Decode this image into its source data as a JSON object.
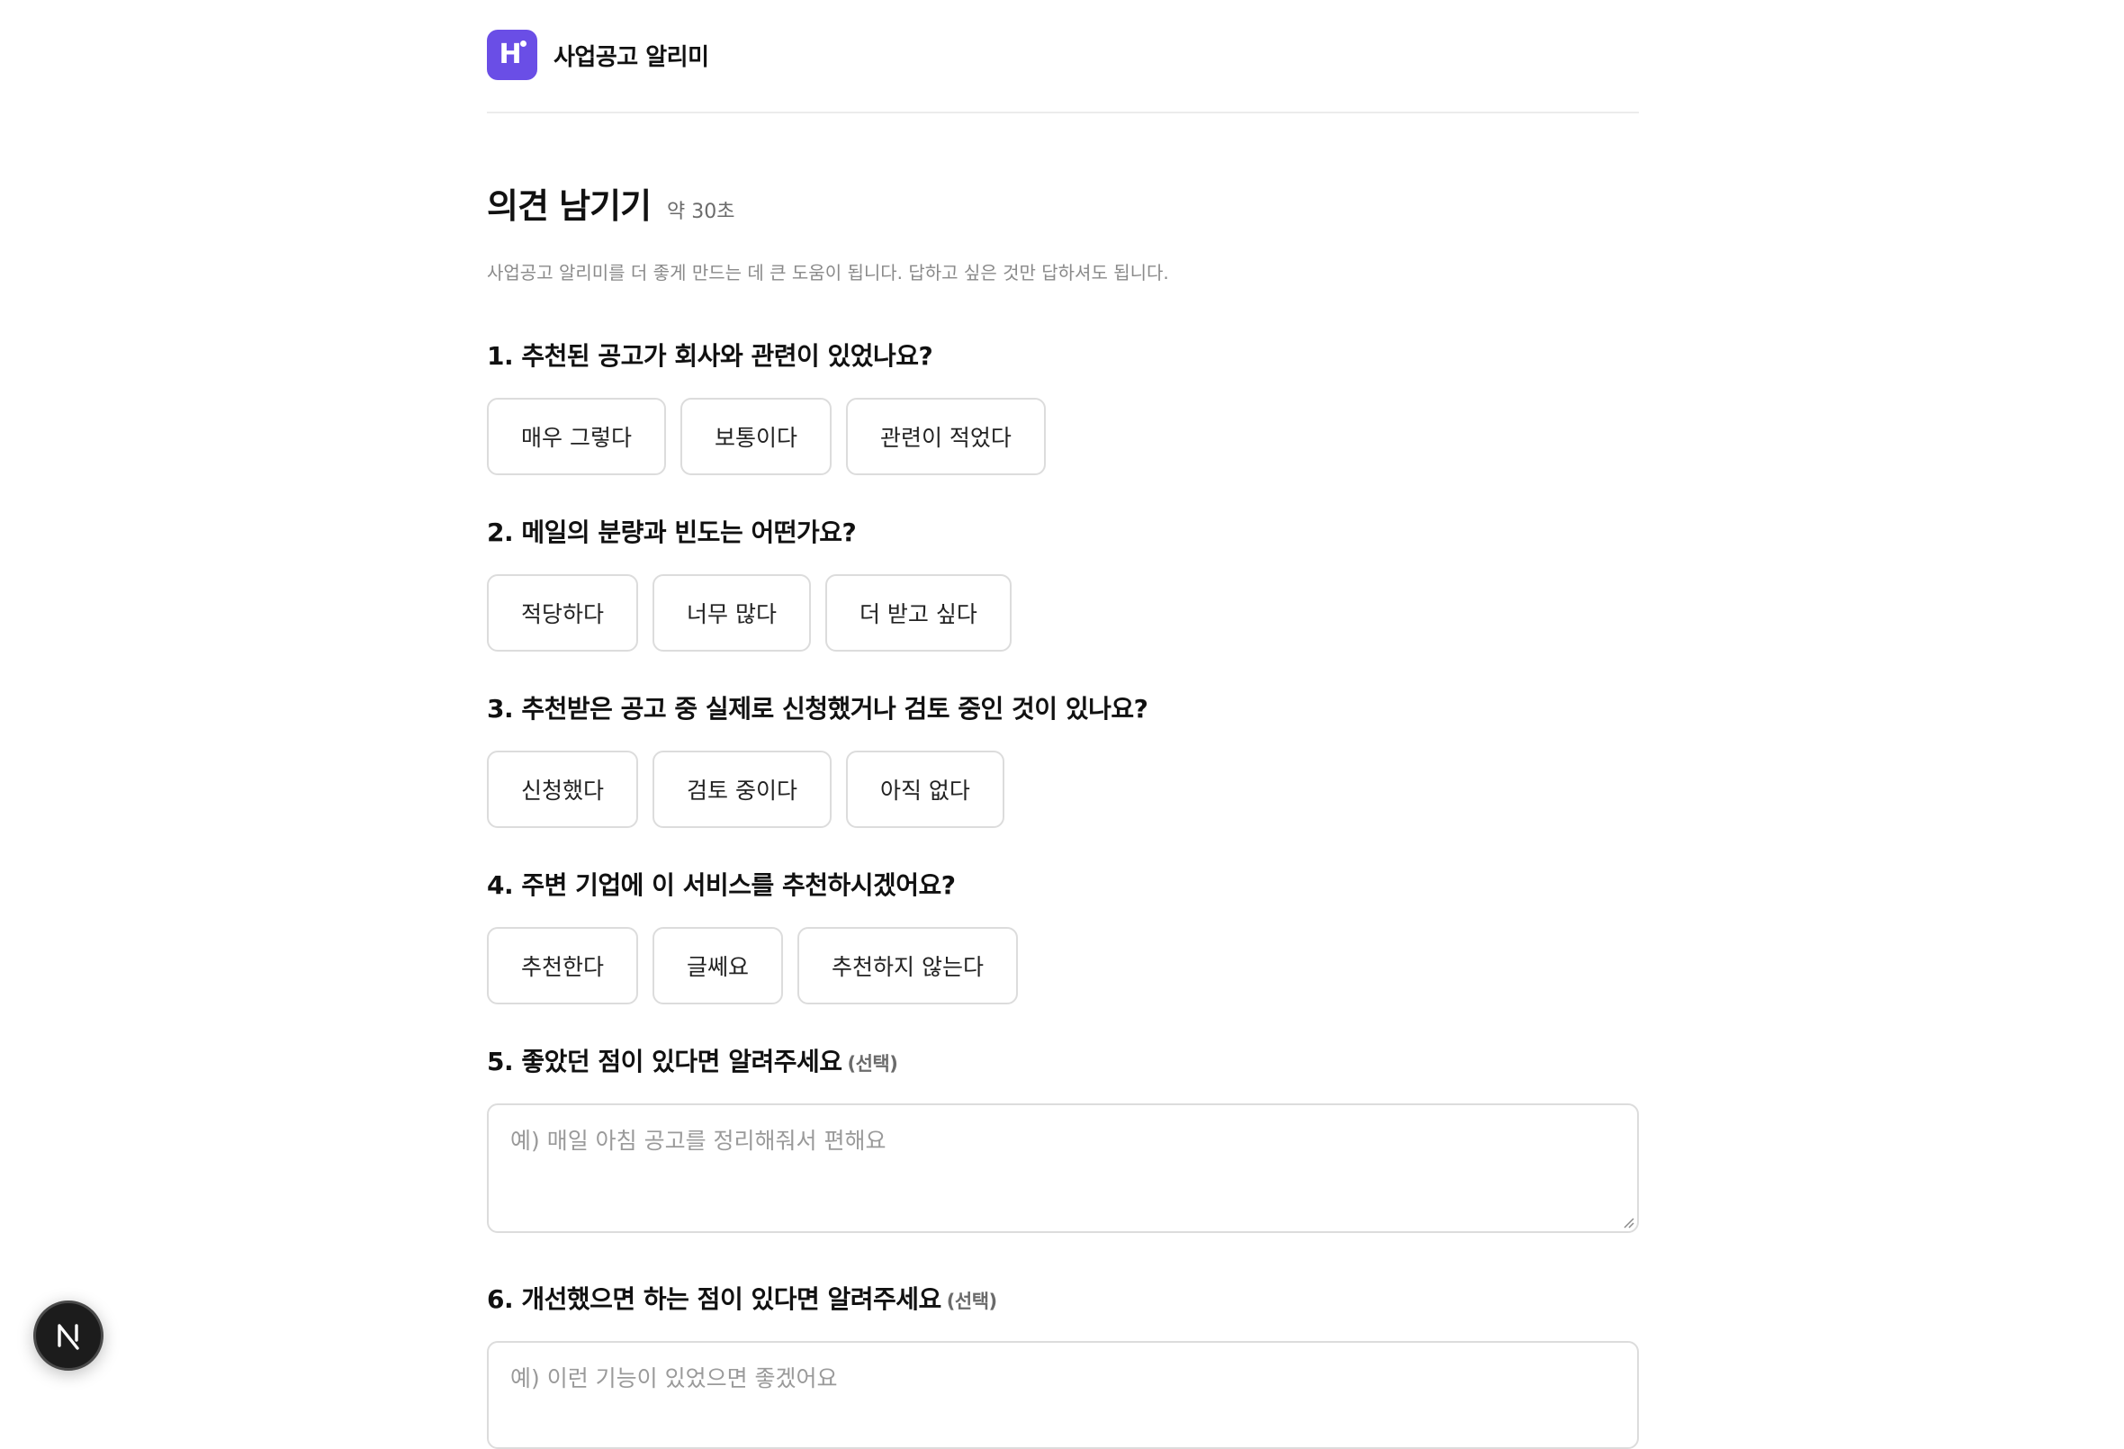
{
  "header": {
    "logo_letter": "H",
    "brand": "사업공고 알리미"
  },
  "page": {
    "title": "의견 남기기",
    "duration": "약 30초",
    "subtitle": "사업공고 알리미를 더 좋게 만드는 데 큰 도움이 됩니다. 답하고 싶은 것만 답하셔도 됩니다."
  },
  "questions": [
    {
      "title": "1. 추천된 공고가 회사와 관련이 있었나요?",
      "options": [
        "매우 그렇다",
        "보통이다",
        "관련이 적었다"
      ]
    },
    {
      "title": "2. 메일의 분량과 빈도는 어떤가요?",
      "options": [
        "적당하다",
        "너무 많다",
        "더 받고 싶다"
      ]
    },
    {
      "title": "3. 추천받은 공고 중 실제로 신청했거나 검토 중인 것이 있나요?",
      "options": [
        "신청했다",
        "검토 중이다",
        "아직 없다"
      ]
    },
    {
      "title": "4. 주변 기업에 이 서비스를 추천하시겠어요?",
      "options": [
        "추천한다",
        "글쎄요",
        "추천하지 않는다"
      ]
    },
    {
      "title": "5. 좋았던 점이 있다면 알려주세요",
      "optional": "(선택)",
      "placeholder": "예) 매일 아침 공고를 정리해줘서 편해요"
    },
    {
      "title": "6. 개선했으면 하는 점이 있다면 알려주세요",
      "optional": "(선택)",
      "placeholder": "예) 이런 기능이 있었으면 좋겠어요"
    }
  ],
  "devtools": {
    "icon": "nextjs-icon",
    "letter": "N"
  }
}
